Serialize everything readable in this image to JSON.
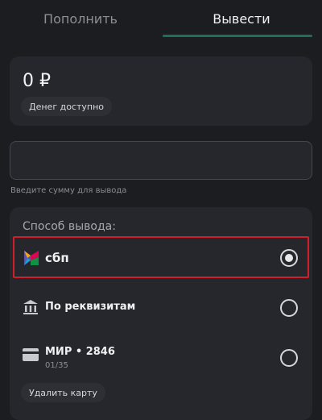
{
  "tabs": {
    "deposit": "Пополнить",
    "withdraw": "Вывести"
  },
  "balance": {
    "amount": "0 ₽",
    "available_label": "Денег доступно"
  },
  "amount_field": {
    "value": "",
    "placeholder": "",
    "hint": "Введите сумму для вывода"
  },
  "withdraw_method": {
    "title": "Способ вывода:",
    "options": [
      {
        "label": "сбп",
        "icon": "sbp-logo-icon",
        "selected": true
      },
      {
        "label": "По реквизитам",
        "icon": "bank-icon",
        "selected": false
      },
      {
        "label": "МИР • 2846",
        "sub": "01/35",
        "icon": "card-icon",
        "selected": false
      }
    ],
    "remove_card_label": "Удалить карту"
  },
  "colors": {
    "background": "#1c1d21",
    "card": "#26272c",
    "tab_underline": "#1f6e5a",
    "selection_outline": "#d01f2a"
  }
}
